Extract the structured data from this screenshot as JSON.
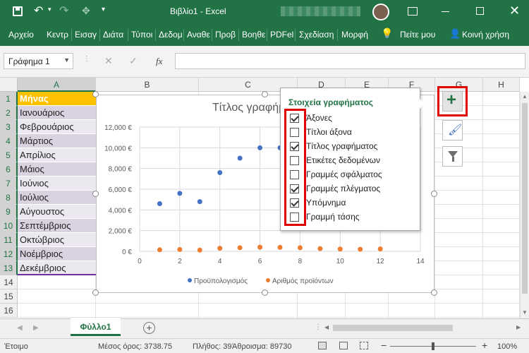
{
  "titlebar": {
    "title": "Βιβλίο1  -  Excel"
  },
  "ribbon": {
    "tabs": [
      "Αρχείο",
      "Κεντρ",
      "Εισαγ",
      "Διάτα",
      "Τύποι",
      "Δεδομ",
      "Αναθε",
      "Προβ",
      "Βοηθε",
      "PDFel",
      "Σχεδίαση",
      "Μορφή"
    ],
    "tell_me": "Πείτε μου",
    "share": "Κοινή χρήση"
  },
  "formula": {
    "name_box": "Γράφημα 1",
    "fx": "fx",
    "formula_value": ""
  },
  "grid": {
    "columns": [
      "A",
      "B",
      "C",
      "D",
      "E",
      "F",
      "G",
      "H"
    ],
    "rows": [
      "1",
      "2",
      "3",
      "4",
      "5",
      "6",
      "7",
      "8",
      "9",
      "10",
      "11",
      "12",
      "13",
      "14",
      "15",
      "16"
    ],
    "colA": [
      "Μήνας",
      "Ιανουάριος",
      "Φεβρουάριος",
      "Μάρτιος",
      "Απρίλιος",
      "Μάιος",
      "Ιούνιος",
      "Ιούλιος",
      "Αύγουστος",
      "Σεπτέμβριος",
      "Οκτώβριος",
      "Νοέμβριος",
      "Δεκέμβριος"
    ]
  },
  "chart_data": {
    "type": "scatter",
    "title": "Τίτλος γραφήματος",
    "xlim": [
      0,
      14
    ],
    "ylim": [
      0,
      12000
    ],
    "x_ticks": [
      "0",
      "2",
      "4",
      "6",
      "8",
      "10",
      "12",
      "14"
    ],
    "y_ticks": [
      "0 €",
      "2,000 €",
      "4,000 €",
      "6,000 €",
      "8,000 €",
      "10,000 €",
      "12,000 €"
    ],
    "grid": true,
    "legend_position": "bottom",
    "series": [
      {
        "name": "Προϋπολογισμός",
        "color": "#4472c4",
        "x": [
          1,
          2,
          3,
          4,
          5,
          6,
          7
        ],
        "y": [
          4600,
          5600,
          4800,
          7600,
          9000,
          10000,
          10000
        ]
      },
      {
        "name": "Αριθμός προϊόντων",
        "color": "#ed7d31",
        "x": [
          1,
          2,
          3,
          4,
          5,
          6,
          7,
          8,
          9,
          10,
          11,
          12
        ],
        "y": [
          150,
          180,
          120,
          300,
          350,
          400,
          380,
          350,
          260,
          220,
          200,
          230
        ]
      }
    ]
  },
  "chart_elements": {
    "title": "Στοιχεία γραφήματος",
    "items": [
      {
        "label": "Άξονες",
        "checked": true
      },
      {
        "label": "Τίτλοι άξονα",
        "checked": false
      },
      {
        "label": "Τίτλος γραφήματος",
        "checked": true
      },
      {
        "label": "Ετικέτες δεδομένων",
        "checked": false
      },
      {
        "label": "Γραμμές σφάλματος",
        "checked": false
      },
      {
        "label": "Γραμμές πλέγματος",
        "checked": true
      },
      {
        "label": "Υπόμνημα",
        "checked": true
      },
      {
        "label": "Γραμμή τάσης",
        "checked": false
      }
    ]
  },
  "sheets": {
    "active": "Φύλλο1"
  },
  "status": {
    "ready": "Έτοιμο",
    "average": "Μέσος όρος: 3738.75",
    "count": "Πλήθος: 39",
    "sum": "Άθροισμα: 89730",
    "zoom": "100%"
  }
}
